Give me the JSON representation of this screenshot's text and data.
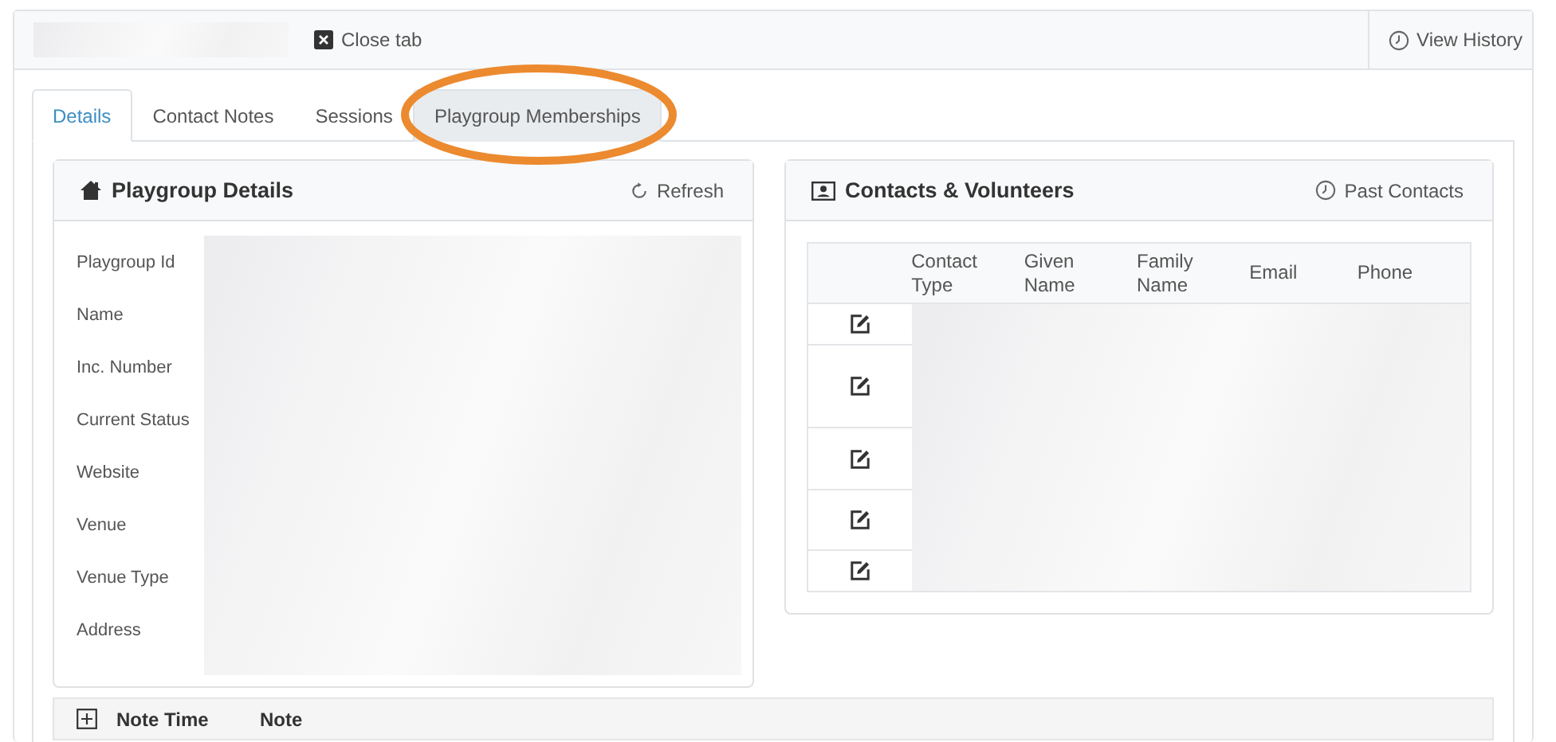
{
  "header": {
    "close_tab": "Close tab",
    "view_history": "View History"
  },
  "tabs": [
    {
      "label": "Details",
      "selected": true,
      "highlighted": false
    },
    {
      "label": "Contact Notes",
      "selected": false,
      "highlighted": false
    },
    {
      "label": "Sessions",
      "selected": false,
      "highlighted": false
    },
    {
      "label": "Playgroup Memberships",
      "selected": false,
      "highlighted": true
    }
  ],
  "playgroup_details": {
    "title": "Playgroup Details",
    "refresh": "Refresh",
    "fields": [
      "Playgroup Id",
      "Name",
      "Inc. Number",
      "Current Status",
      "Website",
      "Venue",
      "Venue Type",
      "Address"
    ]
  },
  "contacts": {
    "title": "Contacts & Volunteers",
    "past_contacts": "Past Contacts",
    "columns": [
      "Contact Type",
      "Given Name",
      "Family Name",
      "Email",
      "Phone"
    ],
    "rows": [
      {
        "kind": "redacted"
      },
      {
        "kind": "redacted"
      },
      {
        "kind": "redacted"
      },
      {
        "kind": "redacted"
      },
      {
        "kind": "redacted"
      }
    ]
  },
  "notes": {
    "columns": [
      "Note Time",
      "Note"
    ]
  }
}
